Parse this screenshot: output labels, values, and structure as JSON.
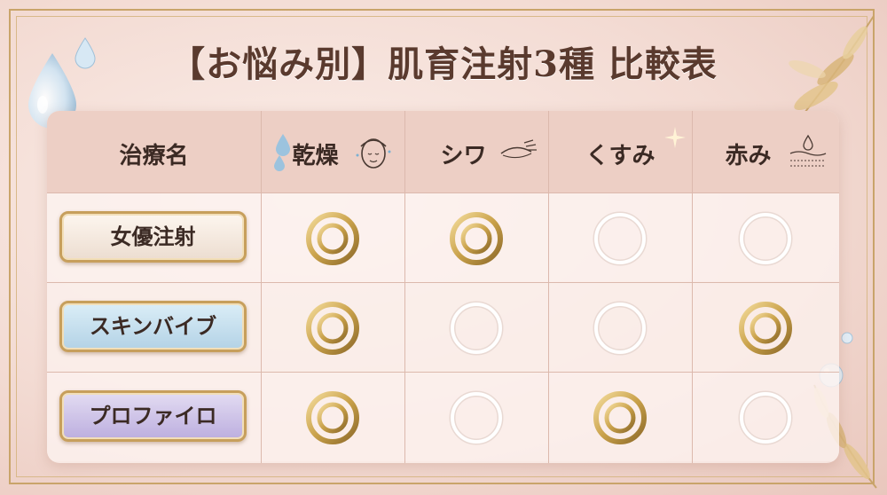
{
  "title": "【お悩み別】肌育注射3種 比較表",
  "columns": [
    {
      "label": "治療名",
      "icon": ""
    },
    {
      "label": "乾燥",
      "icon": "face-drops-icon"
    },
    {
      "label": "シワ",
      "icon": "eye-wrinkle-icon"
    },
    {
      "label": "くすみ",
      "icon": "sparkle-icon"
    },
    {
      "label": "赤み",
      "icon": "skin-layer-icon"
    }
  ],
  "rows": [
    {
      "name": "女優注射",
      "marks": [
        "double",
        "double",
        "single",
        "single"
      ]
    },
    {
      "name": "スキンバイブ",
      "marks": [
        "double",
        "single",
        "single",
        "double"
      ]
    },
    {
      "name": "プロファイロ",
      "marks": [
        "double",
        "single",
        "double",
        "single"
      ]
    }
  ],
  "colors": {
    "gold": "#c9a14a",
    "title": "#5a3a2e",
    "header_bg": "#edcfc5"
  }
}
